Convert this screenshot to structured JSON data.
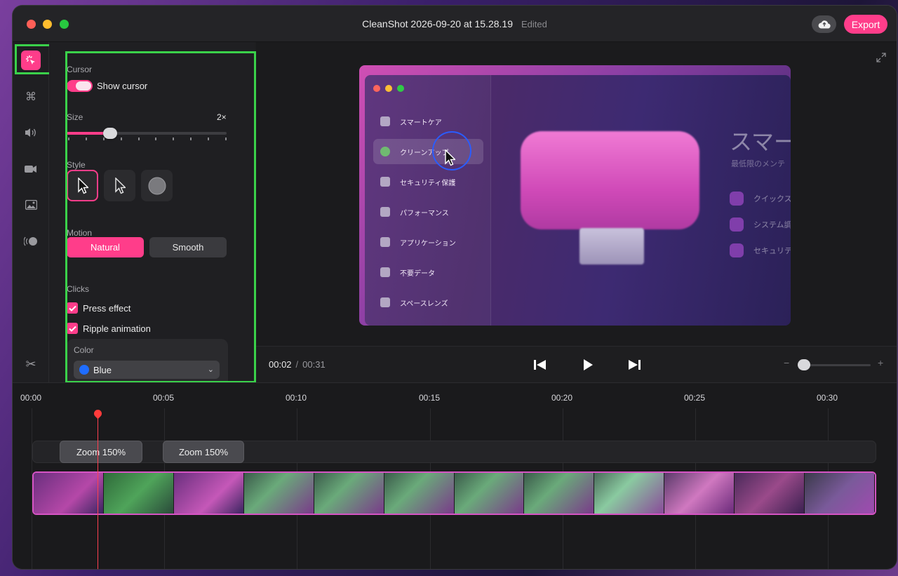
{
  "window": {
    "title": "CleanShot 2026-09-20 at 15.28.19",
    "status": "Edited",
    "export_label": "Export"
  },
  "cursor_panel": {
    "cursor_label": "Cursor",
    "show_cursor_label": "Show cursor",
    "show_cursor_on": true,
    "size_label": "Size",
    "size_value": "2×",
    "size_level": 0.27,
    "style_label": "Style",
    "style_options": [
      "arrow-dark",
      "arrow-light",
      "circle"
    ],
    "style_selected": 0,
    "motion_label": "Motion",
    "motion_options": [
      "Natural",
      "Smooth"
    ],
    "motion_selected": "Natural",
    "clicks_label": "Clicks",
    "press_effect_label": "Press effect",
    "press_effect_checked": true,
    "ripple_label": "Ripple animation",
    "ripple_checked": true,
    "color_label": "Color",
    "color_value": "Blue",
    "color_hex": "#1f6dff"
  },
  "preview": {
    "sidebar_items": [
      "スマートケア",
      "クリーンアップ",
      "セキュリティ保護",
      "パフォーマンス",
      "アプリケーション",
      "不要データ",
      "スペースレンズ"
    ],
    "selected_item": "クリーンアップ",
    "heading": "スマー",
    "subheading": "最低限のメンテ",
    "rows": [
      "クイックス",
      "システム調",
      "セキュリテ"
    ]
  },
  "transport": {
    "current_time": "00:02",
    "separator": "/",
    "total_time": "00:31",
    "zoom_minus": "−",
    "zoom_plus": "+"
  },
  "timeline": {
    "ruler": [
      "00:00",
      "00:05",
      "00:10",
      "00:15",
      "00:20",
      "00:25",
      "00:30"
    ],
    "zoom_segments": [
      "Zoom 150%",
      "Zoom 150%"
    ]
  },
  "accent": "#ff3d8a"
}
